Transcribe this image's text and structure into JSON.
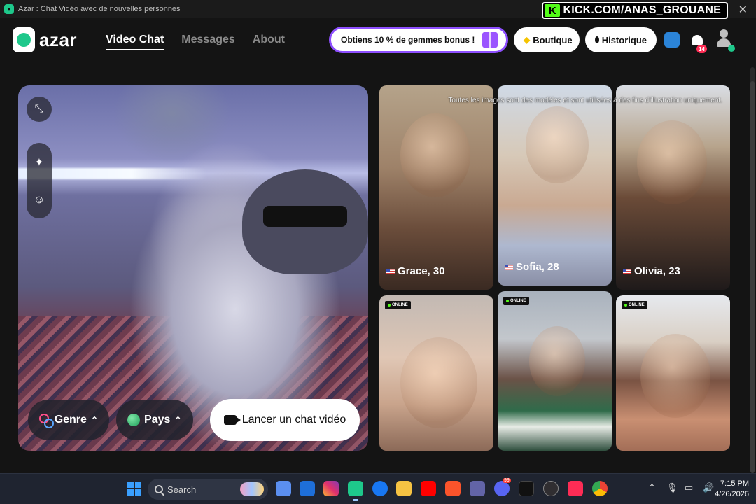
{
  "window": {
    "title": "Azar : Chat Vidéo avec de nouvelles personnes",
    "stream_banner": "KICK.COM/ANAS_GROUANE",
    "close_glyph": "✕"
  },
  "header": {
    "logo_text": "azar",
    "nav": [
      {
        "label": "Video Chat",
        "active": true
      },
      {
        "label": "Messages",
        "active": false
      },
      {
        "label": "About",
        "active": false
      }
    ],
    "promo_text": "Obtiens 10 % de gemmes bonus !",
    "boutique_label": "Boutique",
    "historique_label": "Historique",
    "notification_count": "14",
    "icons": [
      "support-icon",
      "bell-icon",
      "avatar"
    ]
  },
  "video_panel": {
    "tools": [
      "minimize-icon",
      "magic-wand-icon",
      "face-filter-icon"
    ],
    "genre_label": "Genre",
    "pays_label": "Pays",
    "start_button_label": "Lancer un chat vidéo"
  },
  "gallery": {
    "disclaimer": "Toutes les images sont des modèles et sont utilisées à des fins d'illustration uniquement.",
    "online_label": "ONLINE",
    "cards": [
      {
        "name": "Grace, 30",
        "flag": "us-flag"
      },
      {
        "name": "Sofia, 28",
        "flag": "us-flag"
      },
      {
        "name": "Olivia, 23",
        "flag": "us-flag"
      },
      {
        "online": true
      },
      {
        "online": true
      },
      {
        "online": true
      }
    ]
  },
  "taskbar": {
    "search_placeholder": "Search",
    "time": "7:15 PM",
    "date": "4/26/2026",
    "apps": [
      "file-explorer-icon",
      "outlook-icon",
      "instagram-icon",
      "azar-icon",
      "facebook-icon",
      "folder-icon",
      "youtube-icon",
      "brave-icon",
      "teams-icon",
      "discord-icon",
      "tiktok-icon",
      "obs-icon",
      "tiktok-live-icon",
      "chrome-icon"
    ],
    "discord_badge": "99"
  }
}
